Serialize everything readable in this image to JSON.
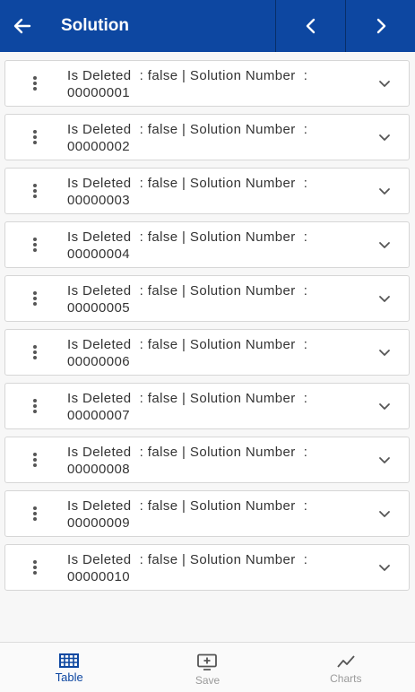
{
  "header": {
    "title": "Solution",
    "back_icon": "arrow-left-icon",
    "prev_icon": "chevron-left-icon",
    "next_icon": "chevron-right-icon"
  },
  "rows": [
    {
      "line1": "Is Deleted  : false | Solution Number  :",
      "line2": "00000001"
    },
    {
      "line1": "Is Deleted  : false | Solution Number  :",
      "line2": "00000002"
    },
    {
      "line1": "Is Deleted  : false | Solution Number  :",
      "line2": "00000003"
    },
    {
      "line1": "Is Deleted  : false | Solution Number  :",
      "line2": "00000004"
    },
    {
      "line1": "Is Deleted  : false | Solution Number  :",
      "line2": "00000005"
    },
    {
      "line1": "Is Deleted  : false | Solution Number  :",
      "line2": "00000006"
    },
    {
      "line1": "Is Deleted  : false | Solution Number  :",
      "line2": "00000007"
    },
    {
      "line1": "Is Deleted  : false | Solution Number  :",
      "line2": "00000008"
    },
    {
      "line1": "Is Deleted  : false | Solution Number  :",
      "line2": "00000009"
    },
    {
      "line1": "Is Deleted  : false | Solution Number  :",
      "line2": "00000010"
    }
  ],
  "bottom_nav": {
    "tabs": [
      {
        "label": "Table",
        "icon": "table-grid-icon",
        "active": true
      },
      {
        "label": "Save",
        "icon": "save-screen-icon",
        "active": false
      },
      {
        "label": "Charts",
        "icon": "line-chart-icon",
        "active": false
      }
    ]
  },
  "colors": {
    "primary": "#0d47a1",
    "inactive": "#9a9a9a"
  }
}
